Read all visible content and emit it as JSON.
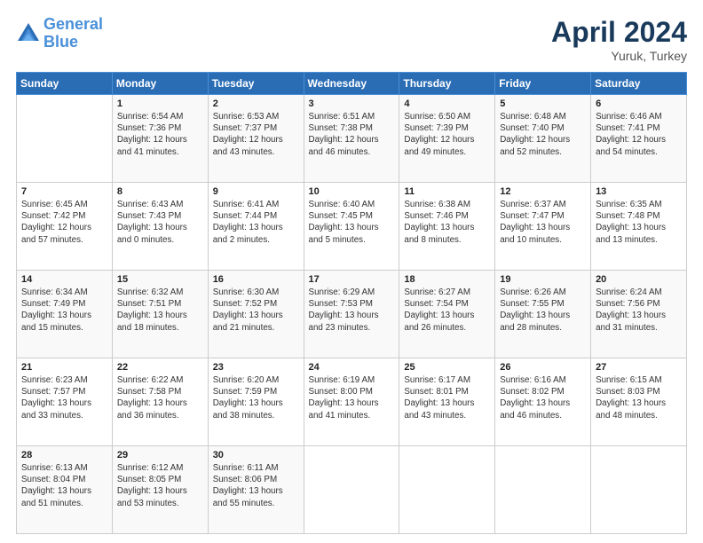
{
  "logo": {
    "line1": "General",
    "line2": "Blue"
  },
  "title": "April 2024",
  "location": "Yuruk, Turkey",
  "days_header": [
    "Sunday",
    "Monday",
    "Tuesday",
    "Wednesday",
    "Thursday",
    "Friday",
    "Saturday"
  ],
  "weeks": [
    [
      {
        "num": "",
        "sunrise": "",
        "sunset": "",
        "daylight": ""
      },
      {
        "num": "1",
        "sunrise": "Sunrise: 6:54 AM",
        "sunset": "Sunset: 7:36 PM",
        "daylight": "Daylight: 12 hours and 41 minutes."
      },
      {
        "num": "2",
        "sunrise": "Sunrise: 6:53 AM",
        "sunset": "Sunset: 7:37 PM",
        "daylight": "Daylight: 12 hours and 43 minutes."
      },
      {
        "num": "3",
        "sunrise": "Sunrise: 6:51 AM",
        "sunset": "Sunset: 7:38 PM",
        "daylight": "Daylight: 12 hours and 46 minutes."
      },
      {
        "num": "4",
        "sunrise": "Sunrise: 6:50 AM",
        "sunset": "Sunset: 7:39 PM",
        "daylight": "Daylight: 12 hours and 49 minutes."
      },
      {
        "num": "5",
        "sunrise": "Sunrise: 6:48 AM",
        "sunset": "Sunset: 7:40 PM",
        "daylight": "Daylight: 12 hours and 52 minutes."
      },
      {
        "num": "6",
        "sunrise": "Sunrise: 6:46 AM",
        "sunset": "Sunset: 7:41 PM",
        "daylight": "Daylight: 12 hours and 54 minutes."
      }
    ],
    [
      {
        "num": "7",
        "sunrise": "Sunrise: 6:45 AM",
        "sunset": "Sunset: 7:42 PM",
        "daylight": "Daylight: 12 hours and 57 minutes."
      },
      {
        "num": "8",
        "sunrise": "Sunrise: 6:43 AM",
        "sunset": "Sunset: 7:43 PM",
        "daylight": "Daylight: 13 hours and 0 minutes."
      },
      {
        "num": "9",
        "sunrise": "Sunrise: 6:41 AM",
        "sunset": "Sunset: 7:44 PM",
        "daylight": "Daylight: 13 hours and 2 minutes."
      },
      {
        "num": "10",
        "sunrise": "Sunrise: 6:40 AM",
        "sunset": "Sunset: 7:45 PM",
        "daylight": "Daylight: 13 hours and 5 minutes."
      },
      {
        "num": "11",
        "sunrise": "Sunrise: 6:38 AM",
        "sunset": "Sunset: 7:46 PM",
        "daylight": "Daylight: 13 hours and 8 minutes."
      },
      {
        "num": "12",
        "sunrise": "Sunrise: 6:37 AM",
        "sunset": "Sunset: 7:47 PM",
        "daylight": "Daylight: 13 hours and 10 minutes."
      },
      {
        "num": "13",
        "sunrise": "Sunrise: 6:35 AM",
        "sunset": "Sunset: 7:48 PM",
        "daylight": "Daylight: 13 hours and 13 minutes."
      }
    ],
    [
      {
        "num": "14",
        "sunrise": "Sunrise: 6:34 AM",
        "sunset": "Sunset: 7:49 PM",
        "daylight": "Daylight: 13 hours and 15 minutes."
      },
      {
        "num": "15",
        "sunrise": "Sunrise: 6:32 AM",
        "sunset": "Sunset: 7:51 PM",
        "daylight": "Daylight: 13 hours and 18 minutes."
      },
      {
        "num": "16",
        "sunrise": "Sunrise: 6:30 AM",
        "sunset": "Sunset: 7:52 PM",
        "daylight": "Daylight: 13 hours and 21 minutes."
      },
      {
        "num": "17",
        "sunrise": "Sunrise: 6:29 AM",
        "sunset": "Sunset: 7:53 PM",
        "daylight": "Daylight: 13 hours and 23 minutes."
      },
      {
        "num": "18",
        "sunrise": "Sunrise: 6:27 AM",
        "sunset": "Sunset: 7:54 PM",
        "daylight": "Daylight: 13 hours and 26 minutes."
      },
      {
        "num": "19",
        "sunrise": "Sunrise: 6:26 AM",
        "sunset": "Sunset: 7:55 PM",
        "daylight": "Daylight: 13 hours and 28 minutes."
      },
      {
        "num": "20",
        "sunrise": "Sunrise: 6:24 AM",
        "sunset": "Sunset: 7:56 PM",
        "daylight": "Daylight: 13 hours and 31 minutes."
      }
    ],
    [
      {
        "num": "21",
        "sunrise": "Sunrise: 6:23 AM",
        "sunset": "Sunset: 7:57 PM",
        "daylight": "Daylight: 13 hours and 33 minutes."
      },
      {
        "num": "22",
        "sunrise": "Sunrise: 6:22 AM",
        "sunset": "Sunset: 7:58 PM",
        "daylight": "Daylight: 13 hours and 36 minutes."
      },
      {
        "num": "23",
        "sunrise": "Sunrise: 6:20 AM",
        "sunset": "Sunset: 7:59 PM",
        "daylight": "Daylight: 13 hours and 38 minutes."
      },
      {
        "num": "24",
        "sunrise": "Sunrise: 6:19 AM",
        "sunset": "Sunset: 8:00 PM",
        "daylight": "Daylight: 13 hours and 41 minutes."
      },
      {
        "num": "25",
        "sunrise": "Sunrise: 6:17 AM",
        "sunset": "Sunset: 8:01 PM",
        "daylight": "Daylight: 13 hours and 43 minutes."
      },
      {
        "num": "26",
        "sunrise": "Sunrise: 6:16 AM",
        "sunset": "Sunset: 8:02 PM",
        "daylight": "Daylight: 13 hours and 46 minutes."
      },
      {
        "num": "27",
        "sunrise": "Sunrise: 6:15 AM",
        "sunset": "Sunset: 8:03 PM",
        "daylight": "Daylight: 13 hours and 48 minutes."
      }
    ],
    [
      {
        "num": "28",
        "sunrise": "Sunrise: 6:13 AM",
        "sunset": "Sunset: 8:04 PM",
        "daylight": "Daylight: 13 hours and 51 minutes."
      },
      {
        "num": "29",
        "sunrise": "Sunrise: 6:12 AM",
        "sunset": "Sunset: 8:05 PM",
        "daylight": "Daylight: 13 hours and 53 minutes."
      },
      {
        "num": "30",
        "sunrise": "Sunrise: 6:11 AM",
        "sunset": "Sunset: 8:06 PM",
        "daylight": "Daylight: 13 hours and 55 minutes."
      },
      {
        "num": "",
        "sunrise": "",
        "sunset": "",
        "daylight": ""
      },
      {
        "num": "",
        "sunrise": "",
        "sunset": "",
        "daylight": ""
      },
      {
        "num": "",
        "sunrise": "",
        "sunset": "",
        "daylight": ""
      },
      {
        "num": "",
        "sunrise": "",
        "sunset": "",
        "daylight": ""
      }
    ]
  ]
}
